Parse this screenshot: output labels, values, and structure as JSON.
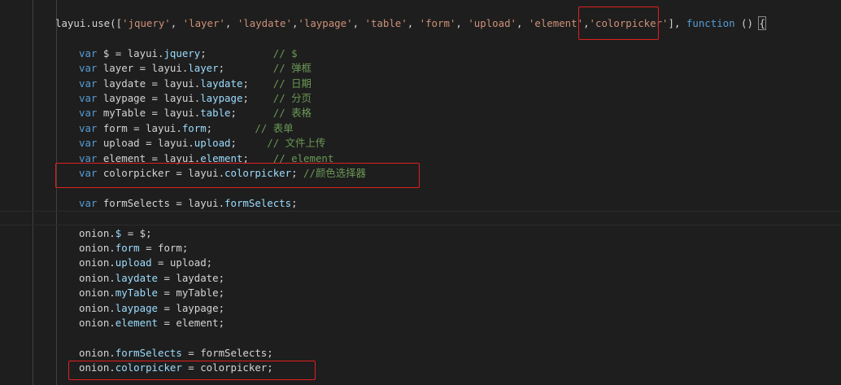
{
  "editor": {
    "theme_colors": {
      "background": "#1e1e1e",
      "keyword": "#569cd6",
      "identifier": "#9cdcfe",
      "string": "#ce9178",
      "comment": "#6a9955",
      "highlight_box": "#e01f1f"
    },
    "lines": [
      {
        "tokens": [
          {
            "t": "layui.use([",
            "c": "tx"
          },
          {
            "t": "'jquery'",
            "c": "str"
          },
          {
            "t": ", ",
            "c": "tx"
          },
          {
            "t": "'layer'",
            "c": "str"
          },
          {
            "t": ", ",
            "c": "tx"
          },
          {
            "t": "'laydate'",
            "c": "str"
          },
          {
            "t": ",",
            "c": "tx"
          },
          {
            "t": "'laypage'",
            "c": "str"
          },
          {
            "t": ", ",
            "c": "tx"
          },
          {
            "t": "'table'",
            "c": "str"
          },
          {
            "t": ", ",
            "c": "tx"
          },
          {
            "t": "'form'",
            "c": "str"
          },
          {
            "t": ", ",
            "c": "tx"
          },
          {
            "t": "'upload'",
            "c": "str"
          },
          {
            "t": ", ",
            "c": "tx"
          },
          {
            "t": "'element'",
            "c": "str"
          },
          {
            "t": ",",
            "c": "tx"
          },
          {
            "t": "'colorpicker'",
            "c": "str"
          },
          {
            "t": "], ",
            "c": "tx"
          },
          {
            "t": "function",
            "c": "kw"
          },
          {
            "t": " () ",
            "c": "tx"
          },
          {
            "t": "{",
            "c": "tx",
            "bracket": true
          }
        ]
      },
      {
        "tokens": []
      },
      {
        "tokens": [
          {
            "t": "var",
            "c": "kw"
          },
          {
            "t": " $ = layui.",
            "c": "tx"
          },
          {
            "t": "jquery",
            "c": "id"
          },
          {
            "t": ";           ",
            "c": "tx"
          },
          {
            "t": "// $",
            "c": "cm"
          }
        ]
      },
      {
        "tokens": [
          {
            "t": "var",
            "c": "kw"
          },
          {
            "t": " layer = layui.",
            "c": "tx"
          },
          {
            "t": "layer",
            "c": "id"
          },
          {
            "t": ";        ",
            "c": "tx"
          },
          {
            "t": "// 弹框",
            "c": "cm"
          }
        ]
      },
      {
        "tokens": [
          {
            "t": "var",
            "c": "kw"
          },
          {
            "t": " laydate = layui.",
            "c": "tx"
          },
          {
            "t": "laydate",
            "c": "id"
          },
          {
            "t": ";    ",
            "c": "tx"
          },
          {
            "t": "// 日期",
            "c": "cm"
          }
        ]
      },
      {
        "tokens": [
          {
            "t": "var",
            "c": "kw"
          },
          {
            "t": " laypage = layui.",
            "c": "tx"
          },
          {
            "t": "laypage",
            "c": "id"
          },
          {
            "t": ";    ",
            "c": "tx"
          },
          {
            "t": "// 分页",
            "c": "cm"
          }
        ]
      },
      {
        "tokens": [
          {
            "t": "var",
            "c": "kw"
          },
          {
            "t": " myTable = layui.",
            "c": "tx"
          },
          {
            "t": "table",
            "c": "id"
          },
          {
            "t": ";      ",
            "c": "tx"
          },
          {
            "t": "// 表格",
            "c": "cm"
          }
        ]
      },
      {
        "tokens": [
          {
            "t": "var",
            "c": "kw"
          },
          {
            "t": " form = layui.",
            "c": "tx"
          },
          {
            "t": "form",
            "c": "id"
          },
          {
            "t": ";       ",
            "c": "tx"
          },
          {
            "t": "// 表单",
            "c": "cm"
          }
        ]
      },
      {
        "tokens": [
          {
            "t": "var",
            "c": "kw"
          },
          {
            "t": " upload = layui.",
            "c": "tx"
          },
          {
            "t": "upload",
            "c": "id"
          },
          {
            "t": ";     ",
            "c": "tx"
          },
          {
            "t": "// 文件上传",
            "c": "cm"
          }
        ]
      },
      {
        "tokens": [
          {
            "t": "var",
            "c": "kw"
          },
          {
            "t": " element = layui.",
            "c": "tx"
          },
          {
            "t": "element",
            "c": "id"
          },
          {
            "t": ";    ",
            "c": "tx"
          },
          {
            "t": "// element",
            "c": "cm"
          }
        ]
      },
      {
        "tokens": [
          {
            "t": "var",
            "c": "kw"
          },
          {
            "t": " colorpicker = layui.",
            "c": "tx"
          },
          {
            "t": "colorpicker",
            "c": "id"
          },
          {
            "t": "; ",
            "c": "tx"
          },
          {
            "t": "//颜色选择器",
            "c": "cm"
          }
        ]
      },
      {
        "tokens": []
      },
      {
        "tokens": [
          {
            "t": "var",
            "c": "kw"
          },
          {
            "t": " formSelects = layui.",
            "c": "tx"
          },
          {
            "t": "formSelects",
            "c": "id"
          },
          {
            "t": ";",
            "c": "tx"
          }
        ]
      },
      {
        "tokens": [],
        "current": true
      },
      {
        "tokens": [
          {
            "t": "onion.",
            "c": "tx"
          },
          {
            "t": "$",
            "c": "id"
          },
          {
            "t": " = $;",
            "c": "tx"
          }
        ]
      },
      {
        "tokens": [
          {
            "t": "onion.",
            "c": "tx"
          },
          {
            "t": "form",
            "c": "id"
          },
          {
            "t": " = form;",
            "c": "tx"
          }
        ]
      },
      {
        "tokens": [
          {
            "t": "onion.",
            "c": "tx"
          },
          {
            "t": "upload",
            "c": "id"
          },
          {
            "t": " = upload;",
            "c": "tx"
          }
        ]
      },
      {
        "tokens": [
          {
            "t": "onion.",
            "c": "tx"
          },
          {
            "t": "laydate",
            "c": "id"
          },
          {
            "t": " = laydate;",
            "c": "tx"
          }
        ]
      },
      {
        "tokens": [
          {
            "t": "onion.",
            "c": "tx"
          },
          {
            "t": "myTable",
            "c": "id"
          },
          {
            "t": " = myTable;",
            "c": "tx"
          }
        ]
      },
      {
        "tokens": [
          {
            "t": "onion.",
            "c": "tx"
          },
          {
            "t": "laypage",
            "c": "id"
          },
          {
            "t": " = laypage;",
            "c": "tx"
          }
        ]
      },
      {
        "tokens": [
          {
            "t": "onion.",
            "c": "tx"
          },
          {
            "t": "element",
            "c": "id"
          },
          {
            "t": " = element;",
            "c": "tx"
          }
        ]
      },
      {
        "tokens": []
      },
      {
        "tokens": [
          {
            "t": "onion.",
            "c": "tx"
          },
          {
            "t": "formSelects",
            "c": "id"
          },
          {
            "t": " = formSelects;",
            "c": "tx"
          }
        ]
      },
      {
        "tokens": [
          {
            "t": "onion.",
            "c": "tx"
          },
          {
            "t": "colorpicker",
            "c": "id"
          },
          {
            "t": " = colorpicker;",
            "c": "tx"
          }
        ]
      }
    ]
  }
}
